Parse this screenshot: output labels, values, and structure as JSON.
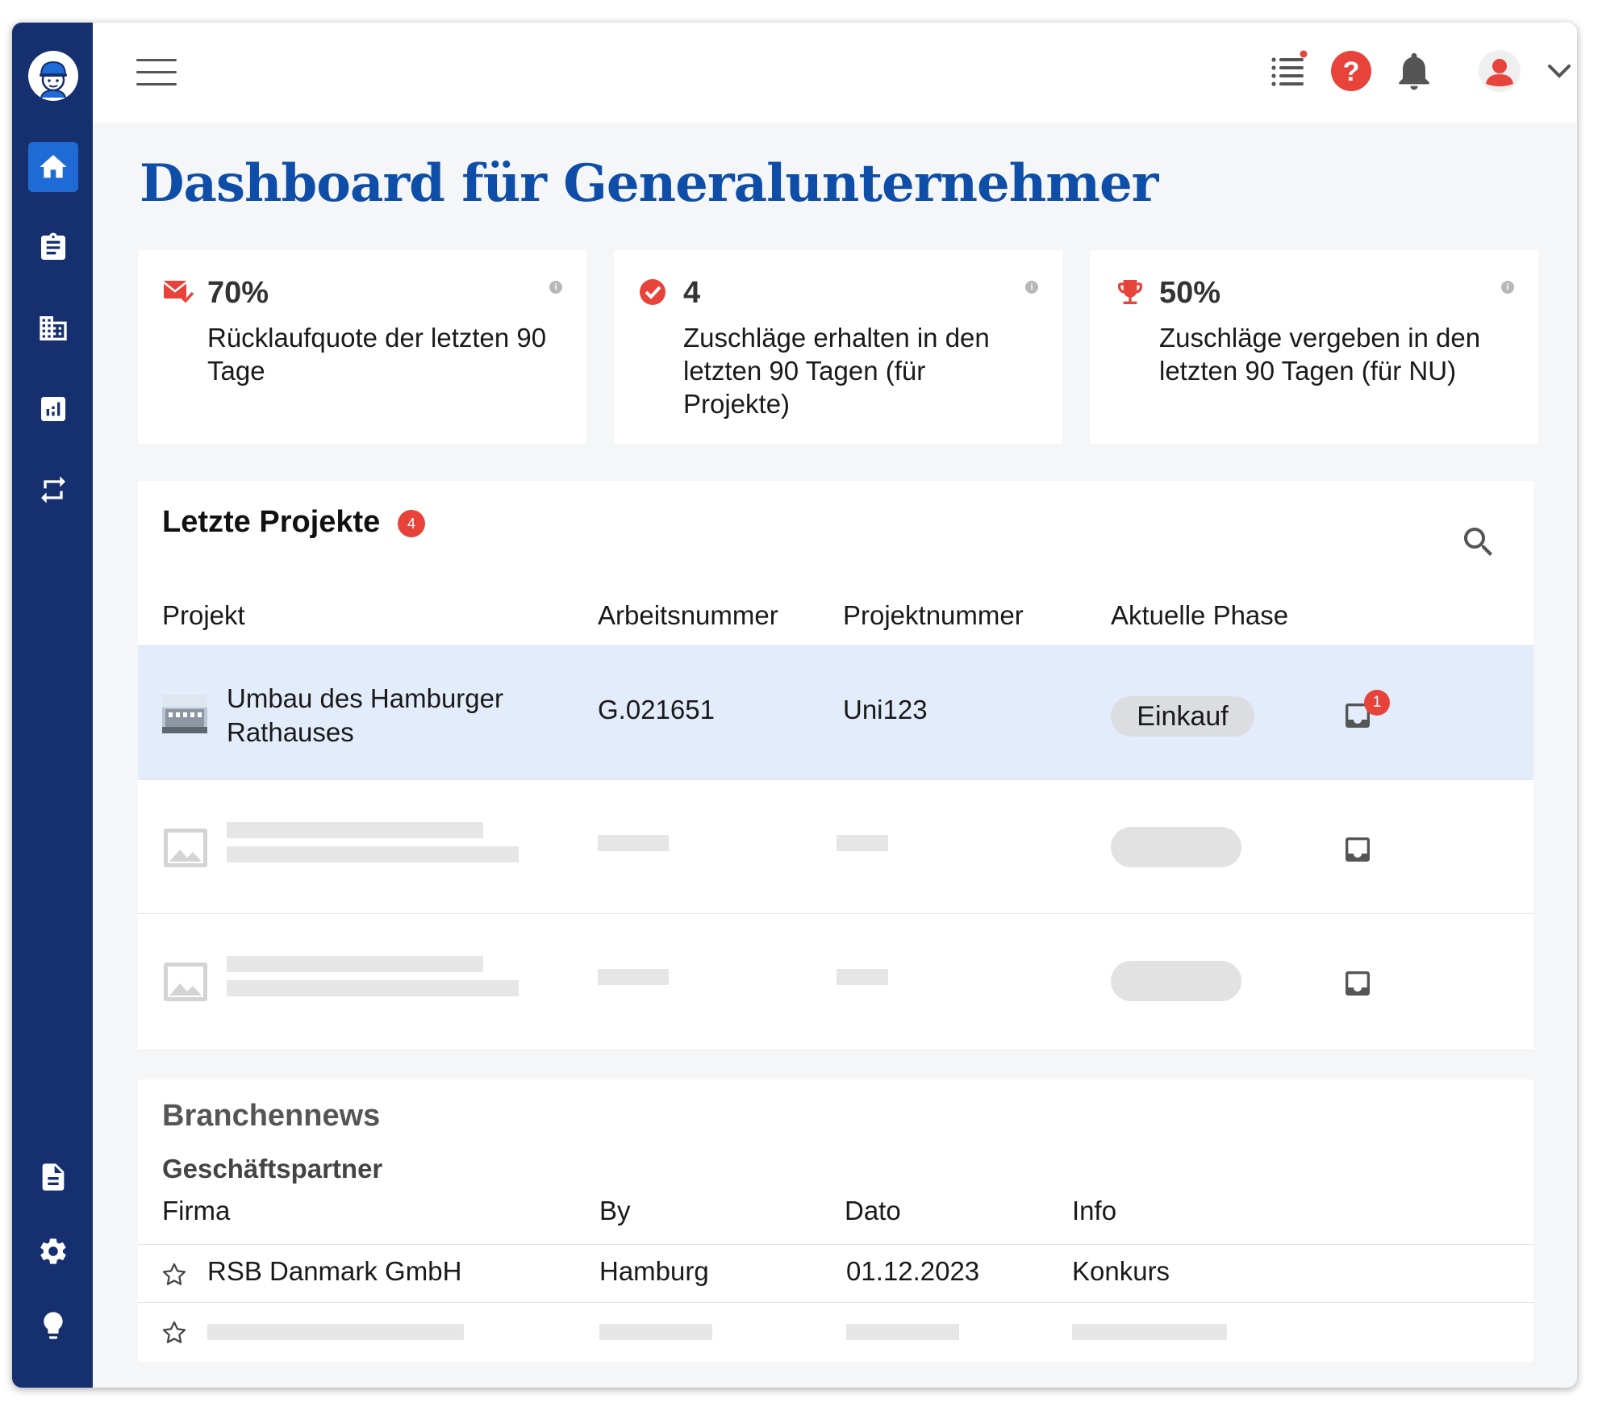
{
  "page": {
    "title": "Dashboard für Generalunternehmer"
  },
  "sidebar": {
    "items": [
      {
        "name": "home",
        "icon": "home-icon",
        "active": true
      },
      {
        "name": "tasks",
        "icon": "clipboard-icon"
      },
      {
        "name": "companies",
        "icon": "building-icon"
      },
      {
        "name": "reports",
        "icon": "bar-chart-icon"
      },
      {
        "name": "exchange",
        "icon": "repeat-icon"
      },
      {
        "name": "documents",
        "icon": "document-icon"
      },
      {
        "name": "settings",
        "icon": "gear-icon"
      },
      {
        "name": "tips",
        "icon": "lightbulb-icon"
      }
    ]
  },
  "topbar": {
    "icons": [
      "menu-icon",
      "task-list-icon",
      "help-icon",
      "bell-icon",
      "user-avatar-icon",
      "chevron-down-icon"
    ]
  },
  "stats": [
    {
      "icon": "mail-check-icon",
      "value": "70%",
      "label": "Rücklaufquote der letzten 90 Tage"
    },
    {
      "icon": "check-circle-icon",
      "value": "4",
      "label": "Zuschläge erhalten in den letzten 90 Tagen (für Projekte)"
    },
    {
      "icon": "trophy-icon",
      "value": "50%",
      "label": "Zuschläge vergeben in den letzten 90 Tagen (für NU)"
    }
  ],
  "projects": {
    "title": "Letzte Projekte",
    "count": "4",
    "columns": [
      "Projekt",
      "Arbeitsnummer",
      "Projektnummer",
      "Aktuelle Phase"
    ],
    "rows": [
      {
        "name": "Umbau des Hamburger Rathauses",
        "work_number": "G.021651",
        "project_number": "Uni123",
        "phase": "Einkauf",
        "notifications": "1"
      }
    ]
  },
  "news": {
    "title": "Branchennews",
    "subtitle": "Geschäftspartner",
    "columns": [
      "Firma",
      "By",
      "Dato",
      "Info"
    ],
    "rows": [
      {
        "company": "RSB Danmark GmbH",
        "city": "Hamburg",
        "date": "01.12.2023",
        "info": "Konkurs"
      }
    ]
  },
  "colors": {
    "sidebar": "#16306f",
    "active": "#1f6bd6",
    "title": "#0f4ea8",
    "accent_red": "#e8433a",
    "highlight_row": "#e3ecfb"
  }
}
